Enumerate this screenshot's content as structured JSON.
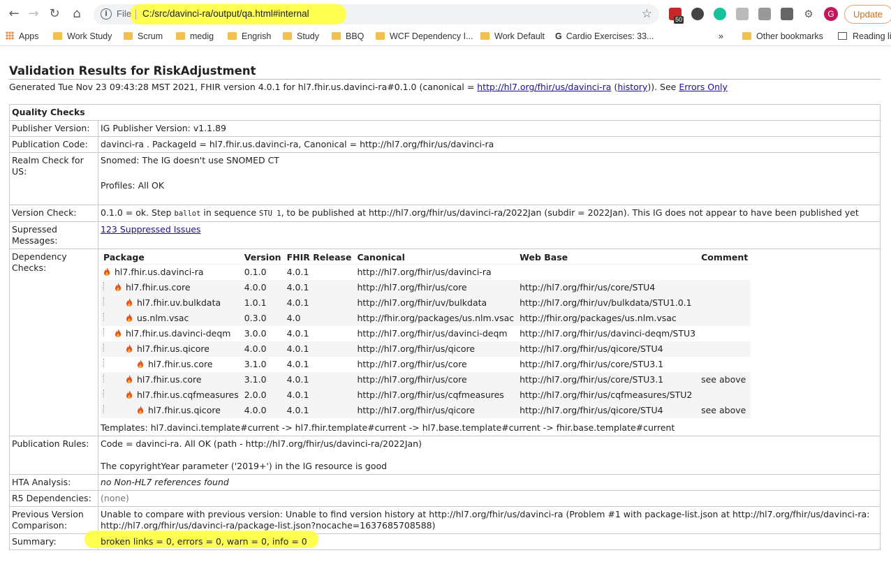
{
  "browser": {
    "scheme": "File",
    "url": "C:/src/davinci-ra/output/qa.html#internal",
    "update_label": "Update",
    "profile_initial": "G",
    "ext_badge": "50"
  },
  "bookmarks": [
    "Apps",
    "Work Study",
    "Scrum",
    "medig",
    "Engrish",
    "Study",
    "BBQ",
    "WCF Dependency I...",
    "Work Default",
    "Cardio Exercises: 33...",
    "»",
    "Other bookmarks",
    "Reading list"
  ],
  "page": {
    "title": "Validation Results for RiskAdjustment",
    "generated_prefix": "Generated Tue Nov 23 09:43:28 MST 2021, FHIR version 4.0.1 for hl7.fhir.us.davinci-ra#0.1.0 (canonical = ",
    "canonical_link": "http://hl7.org/fhir/us/davinci-ra",
    "history_open": " (",
    "history_link": "history",
    "history_close": ")). See ",
    "errors_only_link": "Errors Only"
  },
  "qa": {
    "header": "Quality Checks",
    "publisher_label": "Publisher Version:",
    "publisher_value": "IG Publisher Version: v1.1.89",
    "pubcode_label": "Publication Code:",
    "pubcode_value": "davinci-ra . PackageId = hl7.fhir.us.davinci-ra, Canonical = http://hl7.org/fhir/us/davinci-ra",
    "realm_label": "Realm Check for US:",
    "realm_line1": "Snomed: The IG doesn't use SNOMED CT",
    "realm_line2": "Profiles: All OK",
    "version_label": "Version Check:",
    "version_a": "0.1.0 = ok. Step ",
    "version_code1": "ballot",
    "version_b": " in sequence ",
    "version_code2": "STU 1",
    "version_c": ", to be published at http://hl7.org/fhir/us/davinci-ra/2022Jan (subdir = 2022Jan). This IG does not appear to have been published yet",
    "suppressed_label": "Supressed Messages:",
    "suppressed_link": "123 Suppressed Issues",
    "dependency_label": "Dependency Checks:",
    "dep_headers": [
      "Package",
      "Version",
      "FHIR Release",
      "Canonical",
      "Web Base",
      "Comment"
    ],
    "dep_rows": [
      {
        "pkg": "hl7.fhir.us.davinci-ra",
        "ver": "0.1.0",
        "fhir": "4.0.1",
        "canon": "http://hl7.org/fhir/us/davinci-ra",
        "web": "",
        "comment": ""
      },
      {
        "pkg": "hl7.fhir.us.core",
        "ver": "4.0.0",
        "fhir": "4.0.1",
        "canon": "http://hl7.org/fhir/us/core",
        "web": "http://hl7.org/fhir/us/core/STU4",
        "comment": ""
      },
      {
        "pkg": "hl7.fhir.uv.bulkdata",
        "ver": "1.0.1",
        "fhir": "4.0.1",
        "canon": "http://hl7.org/fhir/uv/bulkdata",
        "web": "http://hl7.org/fhir/uv/bulkdata/STU1.0.1",
        "comment": ""
      },
      {
        "pkg": "us.nlm.vsac",
        "ver": "0.3.0",
        "fhir": "4.0",
        "canon": "http://fhir.org/packages/us.nlm.vsac",
        "web": "http://fhir.org/packages/us.nlm.vsac",
        "comment": ""
      },
      {
        "pkg": "hl7.fhir.us.davinci-deqm",
        "ver": "3.0.0",
        "fhir": "4.0.1",
        "canon": "http://hl7.org/fhir/us/davinci-deqm",
        "web": "http://hl7.org/fhir/us/davinci-deqm/STU3",
        "comment": ""
      },
      {
        "pkg": "hl7.fhir.us.qicore",
        "ver": "4.0.0",
        "fhir": "4.0.1",
        "canon": "http://hl7.org/fhir/us/qicore",
        "web": "http://hl7.org/fhir/us/qicore/STU4",
        "comment": ""
      },
      {
        "pkg": "hl7.fhir.us.core",
        "ver": "3.1.0",
        "fhir": "4.0.1",
        "canon": "http://hl7.org/fhir/us/core",
        "web": "http://hl7.org/fhir/us/core/STU3.1",
        "comment": ""
      },
      {
        "pkg": "hl7.fhir.us.core",
        "ver": "3.1.0",
        "fhir": "4.0.1",
        "canon": "http://hl7.org/fhir/us/core",
        "web": "http://hl7.org/fhir/us/core/STU3.1",
        "comment": "see above"
      },
      {
        "pkg": "hl7.fhir.us.cqfmeasures",
        "ver": "2.0.0",
        "fhir": "4.0.1",
        "canon": "http://hl7.org/fhir/us/cqfmeasures",
        "web": "http://hl7.org/fhir/us/cqfmeasures/STU2",
        "comment": ""
      },
      {
        "pkg": "hl7.fhir.us.qicore",
        "ver": "4.0.0",
        "fhir": "4.0.1",
        "canon": "http://hl7.org/fhir/us/qicore",
        "web": "http://hl7.org/fhir/us/qicore/STU4",
        "comment": "see above"
      }
    ],
    "templates": "Templates: hl7.davinci.template#current -> hl7.fhir.template#current -> hl7.base.template#current -> fhir.base.template#current",
    "pubrules_label": "Publication Rules:",
    "pubrules_line1": "Code = davinci-ra. All OK (path - http://hl7.org/fhir/us/davinci-ra/2022Jan)",
    "pubrules_line2": "The copyrightYear parameter ('2019+') in the IG resource is good",
    "hta_label": "HTA Analysis:",
    "hta_value": "no Non-HL7 references found",
    "r5_label": "R5 Dependencies:",
    "r5_value": "(none)",
    "prev_label": "Previous Version Comparison:",
    "prev_value": "Unable to compare with previous version: Unable to find version history at http://hl7.org/fhir/us/davinci-ra (Problem #1 with package-list.json at http://hl7.org/fhir/us/davinci-ra: http://hl7.org/fhir/us/davinci-ra/package-list.json?nocache=1637685708588)",
    "summary_label": "Summary:",
    "summary_value": "broken links = 0, errors = 0, warn = 0, info = 0"
  },
  "colors": {
    "highlight": "#ffff33",
    "link": "#1a0dab",
    "update": "#d56c1a"
  }
}
